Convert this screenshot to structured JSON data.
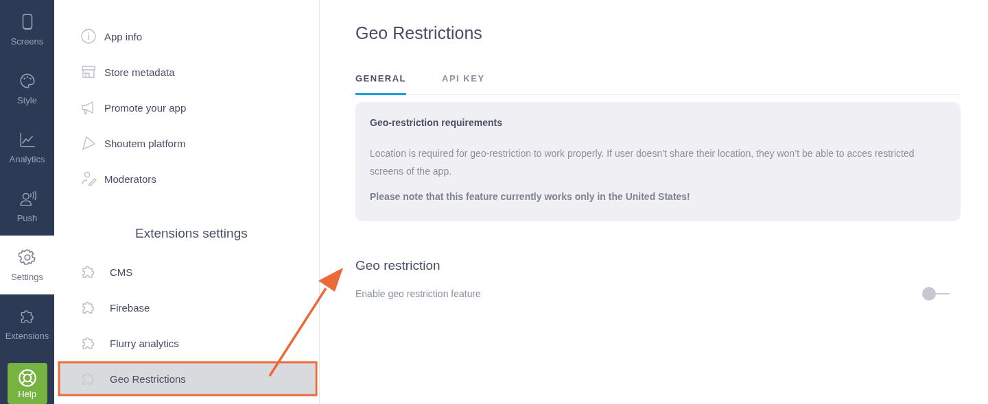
{
  "nav": [
    {
      "label": "Screens",
      "selected": false
    },
    {
      "label": "Style",
      "selected": false
    },
    {
      "label": "Analytics",
      "selected": false
    },
    {
      "label": "Push",
      "selected": false
    },
    {
      "label": "Settings",
      "selected": true
    },
    {
      "label": "Extensions",
      "selected": false
    }
  ],
  "help_button": {
    "label": "Help"
  },
  "settings_menu": {
    "items": [
      {
        "label": "App info",
        "selected": false
      },
      {
        "label": "Store metadata",
        "selected": false
      },
      {
        "label": "Promote your app",
        "selected": false
      },
      {
        "label": "Shoutem platform",
        "selected": false
      },
      {
        "label": "Moderators",
        "selected": false
      }
    ]
  },
  "extensions_menu": {
    "title": "Extensions settings",
    "items": [
      {
        "label": "CMS",
        "selected": false
      },
      {
        "label": "Firebase",
        "selected": false
      },
      {
        "label": "Flurry analytics",
        "selected": false
      },
      {
        "label": "Geo Restrictions",
        "selected": true
      }
    ]
  },
  "page": {
    "title": "Geo Restrictions",
    "tabs": [
      {
        "label": "GENERAL",
        "selected": true
      },
      {
        "label": "API KEY",
        "selected": false
      }
    ],
    "info_card": {
      "title": "Geo-restriction requirements",
      "body": "Location is required for geo-restriction to work properly. If user doesn’t share their location, they won’t be able to acces restricted screens of the app.",
      "note": "Please note that this feature currently works only in the United States!"
    },
    "section": {
      "title": "Geo restriction",
      "setting": {
        "label": "Enable geo restriction feature",
        "on": false
      }
    }
  }
}
